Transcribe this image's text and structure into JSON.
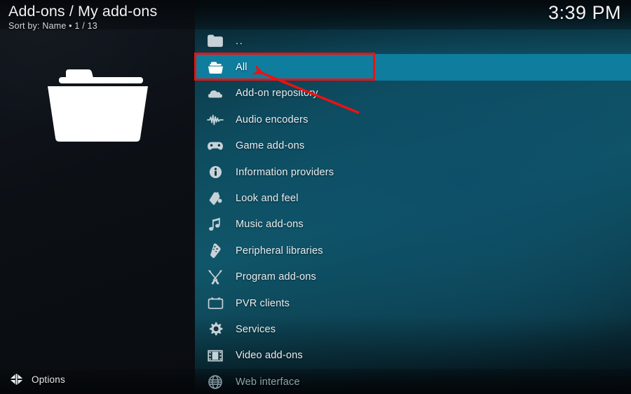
{
  "window": {
    "app": "Kodi",
    "skin_background_colors": {
      "left_panel": "#0c1015",
      "content_gradient_from": "#0e4c5f",
      "content_gradient_to": "#071d26",
      "highlight": "#0f7d9e",
      "annotation": "#ee1111"
    }
  },
  "header": {
    "title": "Add-ons / My add-ons",
    "subtitle": "Sort by: Name  •  1 / 13",
    "sort_by_label": "Sort by:",
    "sort_by_value": "Name",
    "item_position": "1 / 13",
    "current_index": 1,
    "total_items": 13
  },
  "clock": {
    "time": "3:39 PM"
  },
  "preview": {
    "icon": "folder-icon",
    "description": "Large folder thumbnail for selected item"
  },
  "list": {
    "selected_index": 1,
    "items": [
      {
        "label": "..",
        "icon": "folder-up-icon",
        "selected": false,
        "dim": false
      },
      {
        "label": "All",
        "icon": "folder-icon",
        "selected": true,
        "dim": false
      },
      {
        "label": "Add-on repository",
        "icon": "cloud-icon",
        "selected": false,
        "dim": false
      },
      {
        "label": "Audio encoders",
        "icon": "waveform-icon",
        "selected": false,
        "dim": false
      },
      {
        "label": "Game add-ons",
        "icon": "gamepad-icon",
        "selected": false,
        "dim": false
      },
      {
        "label": "Information providers",
        "icon": "info-circle-icon",
        "selected": false,
        "dim": false
      },
      {
        "label": "Look and feel",
        "icon": "paint-bucket-icon",
        "selected": false,
        "dim": false
      },
      {
        "label": "Music add-ons",
        "icon": "music-note-icon",
        "selected": false,
        "dim": false
      },
      {
        "label": "Peripheral libraries",
        "icon": "remote-control-icon",
        "selected": false,
        "dim": false
      },
      {
        "label": "Program add-ons",
        "icon": "tools-icon",
        "selected": false,
        "dim": false
      },
      {
        "label": "PVR clients",
        "icon": "tv-icon",
        "selected": false,
        "dim": false
      },
      {
        "label": "Services",
        "icon": "gear-icon",
        "selected": false,
        "dim": false
      },
      {
        "label": "Video add-ons",
        "icon": "film-strip-icon",
        "selected": false,
        "dim": false
      },
      {
        "label": "Web interface",
        "icon": "globe-icon",
        "selected": false,
        "dim": true
      }
    ]
  },
  "footer": {
    "options_label": "Options",
    "options_icon": "left-right-chevrons-icon"
  },
  "annotation": {
    "type": "red-box-with-arrow",
    "target_label": "All",
    "color": "#ee1111"
  }
}
